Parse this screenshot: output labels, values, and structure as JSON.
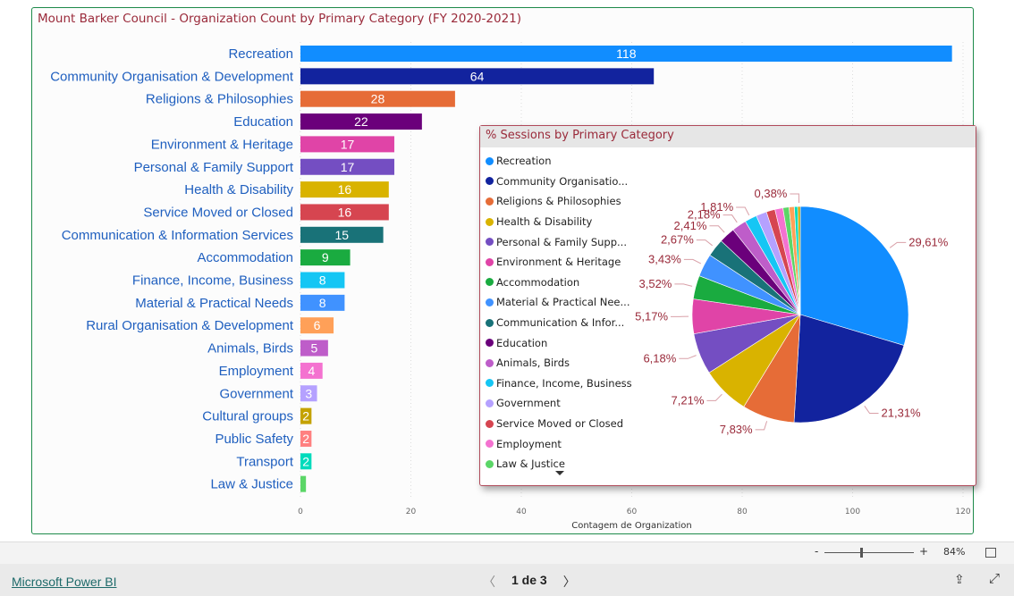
{
  "bar_chart": {
    "title": "Mount Barker Council - Organization Count by Primary Category (FY 2020-2021)",
    "type": "bar",
    "orientation": "horizontal",
    "xlabel": "Contagem de Organization",
    "xlim": [
      0,
      120
    ],
    "ticks": [
      "0",
      "20",
      "40",
      "60",
      "80",
      "100",
      "120"
    ],
    "grid": true,
    "categories": [
      "Recreation",
      "Community Organisation & Development",
      "Religions & Philosophies",
      "Education",
      "Environment & Heritage",
      "Personal & Family Support",
      "Health & Disability",
      "Service Moved or Closed",
      "Communication & Information Services",
      "Accommodation",
      "Finance, Income, Business",
      "Material & Practical Needs",
      "Rural Organisation & Development",
      "Animals, Birds",
      "Employment",
      "Government",
      "Cultural groups",
      "Public Safety",
      "Transport",
      "Law & Justice"
    ],
    "values": [
      118,
      64,
      28,
      22,
      17,
      17,
      16,
      16,
      15,
      9,
      8,
      8,
      6,
      5,
      4,
      3,
      2,
      2,
      2,
      1
    ],
    "labels": [
      "118",
      "64",
      "28",
      "22",
      "17",
      "17",
      "16",
      "16",
      "15",
      "9",
      "8",
      "8",
      "6",
      "5",
      "4",
      "3",
      "2",
      "2",
      "2",
      ""
    ],
    "colors": [
      "#118DFF",
      "#12239E",
      "#E66C37",
      "#6B007B",
      "#E044A7",
      "#744EC2",
      "#D9B300",
      "#D64550",
      "#197278",
      "#1AAB40",
      "#15C6F4",
      "#4092FF",
      "#FFA058",
      "#BE5DC9",
      "#F472D0",
      "#B5A1FF",
      "#C4A200",
      "#FF8080",
      "#00DBBC",
      "#5BD667"
    ]
  },
  "chart_data": {
    "type": "pie",
    "title": "% Sessions by Primary Category",
    "legend_position": "left",
    "categories": [
      "Recreation",
      "Community Organisatio...",
      "Religions & Philosophies",
      "Health & Disability",
      "Personal & Family Supp...",
      "Environment & Heritage",
      "Accommodation",
      "Material & Practical Nee...",
      "Communication & Infor...",
      "Education",
      "Animals, Birds",
      "Finance, Income, Business",
      "Government",
      "Service Moved or Closed",
      "Employment",
      "Law & Justice",
      "Rural Organisation & Development",
      "Transport",
      "Cultural groups"
    ],
    "legend_visible_count": 16,
    "values": [
      29.61,
      21.31,
      7.83,
      7.21,
      6.18,
      5.17,
      3.52,
      3.43,
      2.67,
      2.41,
      2.18,
      1.81,
      1.6,
      1.3,
      1.2,
      0.9,
      0.8,
      0.49,
      0.38
    ],
    "labels": [
      "29,61%",
      "21,31%",
      "7,83%",
      "7,21%",
      "6,18%",
      "5,17%",
      "3,52%",
      "3,43%",
      "2,67%",
      "2,41%",
      "2,18%",
      "1,81%",
      "",
      "",
      "",
      "",
      "",
      "",
      "0,38%"
    ],
    "colors": [
      "#118DFF",
      "#12239E",
      "#E66C37",
      "#D9B300",
      "#744EC2",
      "#E044A7",
      "#1AAB40",
      "#4092FF",
      "#197278",
      "#6B007B",
      "#BE5DC9",
      "#15C6F4",
      "#B5A1FF",
      "#D64550",
      "#F472D0",
      "#5BD667",
      "#FFA058",
      "#00DBBC",
      "#C4A200"
    ]
  },
  "zoom": {
    "minus": "-",
    "plus": "+",
    "level": "84%"
  },
  "footer": {
    "brand": "Microsoft Power BI",
    "page": "1 de 3",
    "prev": "〈",
    "next": "〉"
  }
}
